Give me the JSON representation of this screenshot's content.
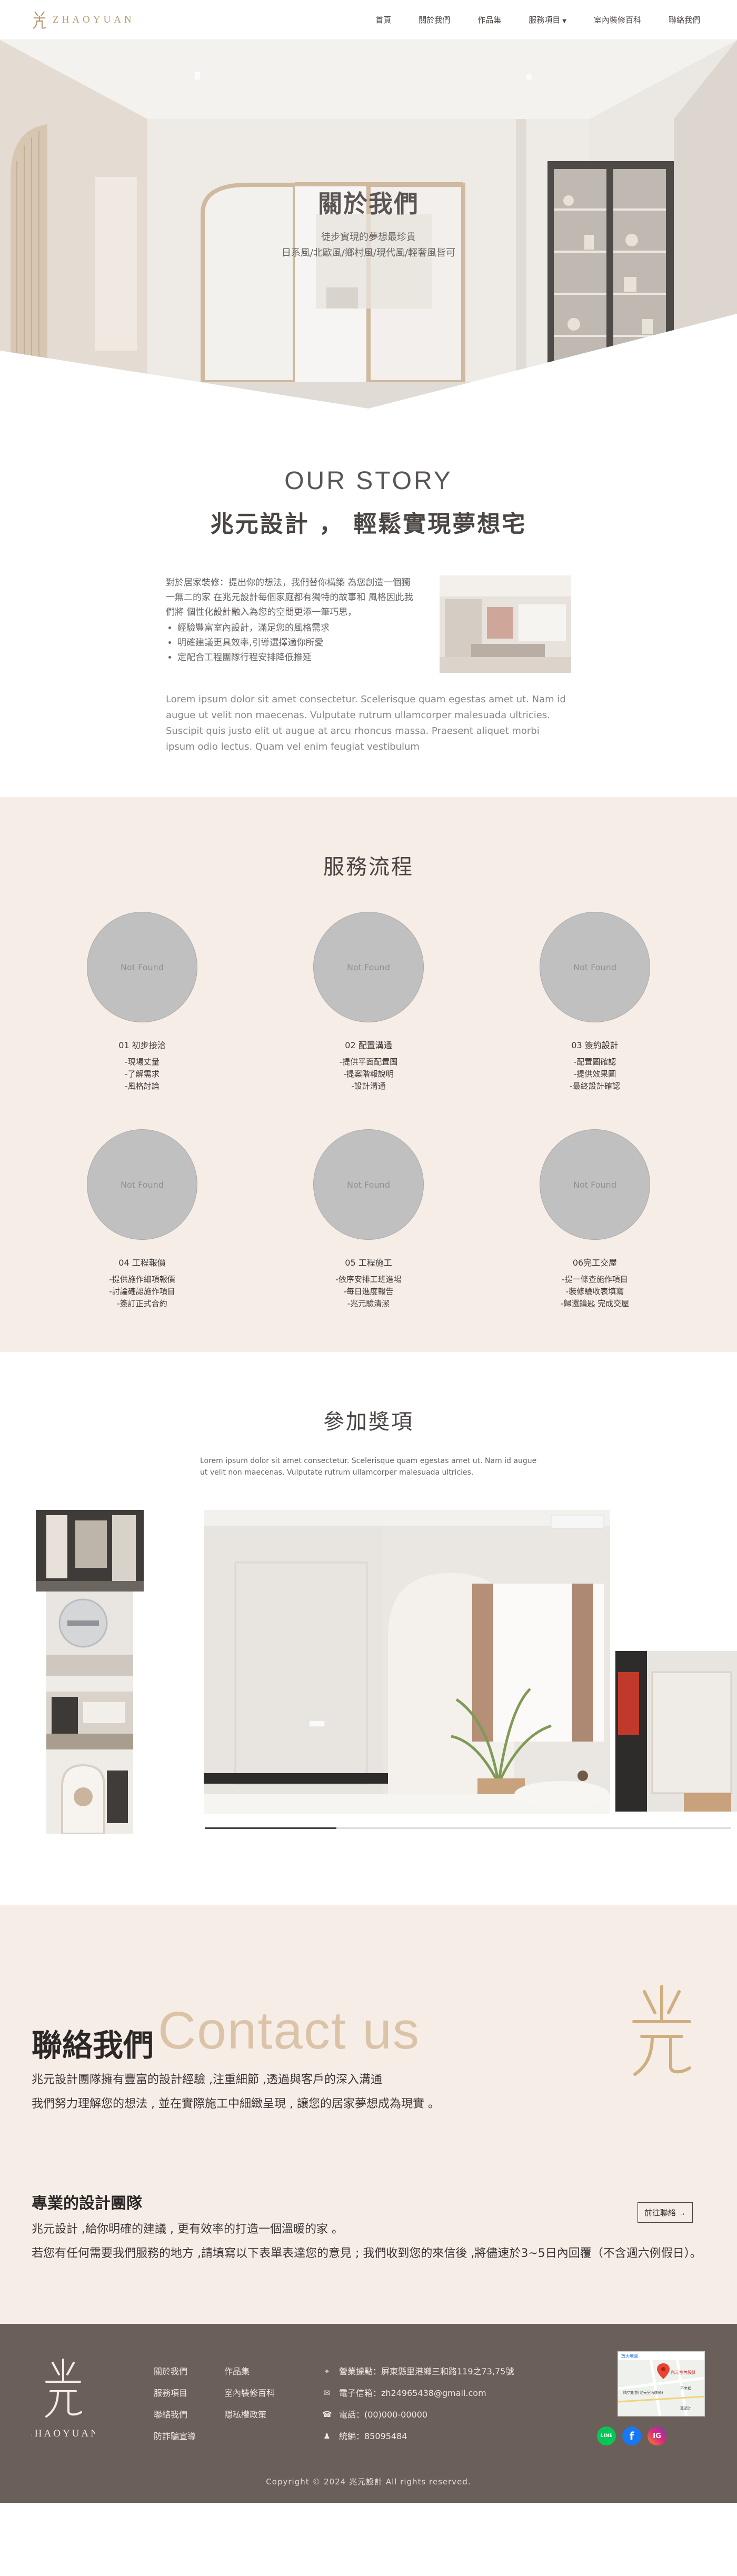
{
  "brand": {
    "name": "ZHAOYUAN"
  },
  "nav": {
    "items": [
      "首頁",
      "關於我們",
      "作品集",
      "服務項目",
      "室內裝修百科",
      "聯絡我們"
    ]
  },
  "hero": {
    "title": "關於我們",
    "subtitle_1": "徒步實現的夢想最珍貴",
    "subtitle_2": "日系風/北歐風/鄉村風/現代風/輕奢風皆可"
  },
  "story": {
    "eyebrow": "OUR STORY",
    "title": "兆元設計 ， 輕鬆實現夢想宅",
    "intro": "對於居家裝修：提出你的想法，我們替你構築 為您創造一個獨一無二的家 在兆元設計每個家庭都有獨特的故事和 風格因此我們將 個性化設計融入為您的空間更添一筆巧思，",
    "bullets": [
      "經驗豐富室內設計，滿足您的風格需求",
      "明確建議更具效率,引導選擇適你所愛",
      "定配合工程團隊行程安排降低推延"
    ],
    "lorem": "Lorem ipsum dolor sit amet consectetur. Scelerisque quam egestas amet ut. Nam id augue ut velit non maecenas. Vulputate rutrum ullamcorper malesuada ultricies. Suscipit quis justo elit ut augue at arcu rhoncus massa. Praesent aliquet morbi ipsum odio lectus. Quam vel enim feugiat vestibulum"
  },
  "services": {
    "title": "服務流程",
    "placeholder": "Not Found",
    "steps": [
      {
        "title": "01 初步接洽",
        "items": [
          "-現場丈量",
          "-了解需求",
          "-風格討論"
        ]
      },
      {
        "title": "02 配置溝通",
        "items": [
          "-提供平面配置圖",
          "-提案階報說明",
          "-設計溝通"
        ]
      },
      {
        "title": "03 簽約設計",
        "items": [
          "-配置圖確認",
          "-提供效果圖",
          "-最終設計確認"
        ]
      },
      {
        "title": "04 工程報價",
        "items": [
          "-提供施作細項報價",
          "-討論確認施作項目",
          "-簽訂正式合約"
        ]
      },
      {
        "title": "05 工程施工",
        "items": [
          "-依序安排工班進場",
          "-每日進度報告",
          "-兆元驗清潔"
        ]
      },
      {
        "title": "06完工交屋",
        "items": [
          "-提一條查施作項目",
          "-裝修驗收表填寫",
          "-歸還鑰匙 完成交屋"
        ]
      }
    ]
  },
  "awards": {
    "title": "參加獎項",
    "intro": "Lorem ipsum dolor sit amet consectetur. Scelerisque quam egestas amet ut. Nam id augue ut velit non maecenas. Vulputate rutrum ullamcorper malesuada ultricies.",
    "slider_progress": 0.25
  },
  "contact": {
    "title": "聯絡我們",
    "bg_word": "Contact us",
    "p1": "兆元設計團隊擁有豐富的設計經驗 ,注重細節 ,透過與客戶的深入溝通",
    "p2": "我們努力理解您的想法 , 並在實際施工中細緻呈現 , 讓您的居家夢想成為現實 。",
    "cta": "前往聯絡 →",
    "team_title": "專業的設計團隊",
    "team_p1": "兆元設計 ,給你明確的建議 , 更有效率的打造一個溫暖的家 。",
    "team_p2": "若您有任何需要我們服務的地方 ,請填寫以下表單表達您的意見 ; 我們收到您的來信後 ,將儘速於3~5日內回覆（不含週六例假日）。"
  },
  "footer": {
    "col1": [
      "關於我們",
      "服務項目",
      "聯絡我們",
      "防詐騙宣導"
    ],
    "col2": [
      "作品集",
      "室內裝修百科",
      "隱私權政策"
    ],
    "contact": [
      {
        "icon": "map-pin-icon",
        "text": "營業據點：屏東縣里港鄉三和路119之73,75號"
      },
      {
        "icon": "mail-icon",
        "text": "電子信箱：zh24965438@gmail.com"
      },
      {
        "icon": "phone-icon",
        "text": "電話：(00)000-00000"
      },
      {
        "icon": "user-icon",
        "text": "統編：85095484"
      }
    ],
    "map": {
      "place": "兆元室內設計",
      "link": "放大地圖",
      "label2": "晴空創意(兆元室內裝修)",
      "label3": "不老松",
      "label4": "萬頭江"
    },
    "socials": [
      "LINE",
      "f",
      "IG"
    ],
    "copyright": "Copyright © 2024 兆元設計 All rights reserved."
  },
  "colors": {
    "accent": "#b99a72",
    "beige": "#f6ede7",
    "footer": "#6b5f59"
  }
}
